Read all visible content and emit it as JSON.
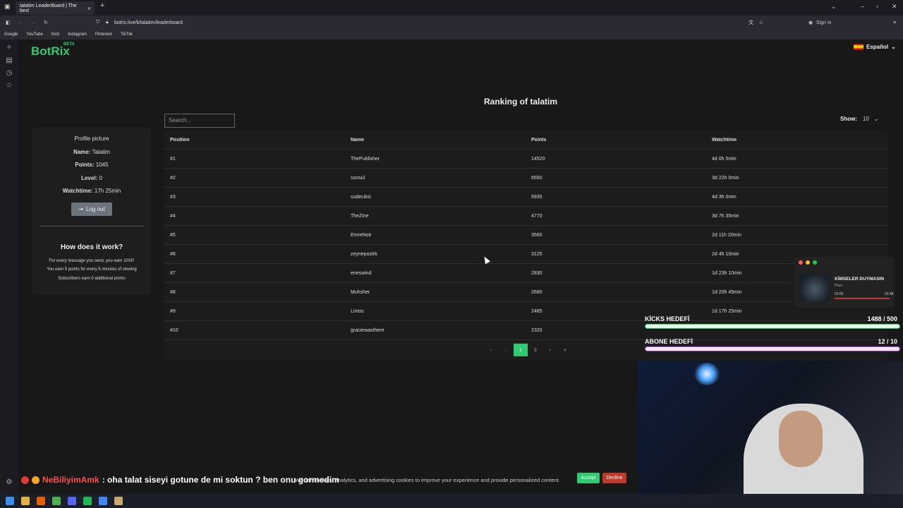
{
  "browser": {
    "tab_title": "talatim LeaderBoard | The best",
    "url": "botrix.live/k/talatim/leaderboard",
    "sign_in": "Sign in",
    "bookmarks": [
      "Google",
      "YouTube",
      "Kick",
      "Instagram",
      "Pinterest",
      "TikTok"
    ]
  },
  "site": {
    "brand": "BotRix",
    "beta": "BETA",
    "language": "Español"
  },
  "profile": {
    "picture_label": "Profile picture",
    "name_label": "Name:",
    "name": "Talatim",
    "points_label": "Points:",
    "points": "1045",
    "level_label": "Level:",
    "level": "0",
    "watchtime_label": "Watchtime:",
    "watchtime": "17h 25min",
    "logout": "Log out",
    "how_title": "How does it work?",
    "how_lines": [
      "For every message you send, you earn 10XP.",
      "You earn 5 points for every 5 minutes of viewing",
      "Subscribers earn 0 additional points"
    ]
  },
  "leaderboard": {
    "title": "Ranking of talatim",
    "search_placeholder": "Search...",
    "show_label": "Show:",
    "show_value": "10",
    "headers": [
      "Position",
      "Name",
      "Points",
      "Watchtime"
    ],
    "rows": [
      [
        "#1",
        "ThePublisher",
        "14520",
        "4d 0h 5min"
      ],
      [
        "#2",
        "sonsul",
        "6550",
        "3d 22h 0min"
      ],
      [
        "#3",
        "sudeciksi",
        "5935",
        "4d 3h 0min"
      ],
      [
        "#4",
        "TheZine",
        "4770",
        "3d 7h 35min"
      ],
      [
        "#5",
        "EmreNoir",
        "3560",
        "2d 11h 20min"
      ],
      [
        "#6",
        "zeynepoztrk",
        "3125",
        "2d 4h 10min"
      ],
      [
        "#7",
        "eneswind",
        "2830",
        "1d 23h 10min"
      ],
      [
        "#8",
        "Muhsher",
        "2680",
        "1d 20h 45min"
      ],
      [
        "#9",
        "Limos",
        "2485",
        "1d 17h 25min"
      ],
      [
        "#10",
        "graciewasthere",
        "2320",
        ""
      ]
    ],
    "pagination": {
      "first": "«",
      "prev": "‹",
      "pages": [
        "1",
        "2"
      ],
      "current": "1",
      "next": "›",
      "last": "»"
    }
  },
  "overlay": {
    "song": "KİMSELER DUYMASIN",
    "artist": "Pozz",
    "time_current": "01:55",
    "time_total": "02:48",
    "kick_goal_label": "KİCKS HEDEFİ",
    "kick_goal_value": "1488  / 500",
    "kick_goal_fraction": 1.0,
    "sub_goal_label": "ABONE HEDEFİ",
    "sub_goal_value": "12  / 10",
    "sub_goal_fraction": 1.0,
    "chat_user": "NeBiliyimAmk",
    "chat_message": ": oha talat siseyi gotune de mi soktun ? ben onu gormedim"
  },
  "cookie": {
    "text": "We use cookies, analytics, and advertising cookies to improve your experience and provide personalized content.",
    "accept": "Accept",
    "decline": "Decline"
  },
  "colors": {
    "accent": "#2ecc71",
    "decline": "#c0392b",
    "kick_bar": "#e8fbe8",
    "sub_bar": "#f3e6ff"
  }
}
